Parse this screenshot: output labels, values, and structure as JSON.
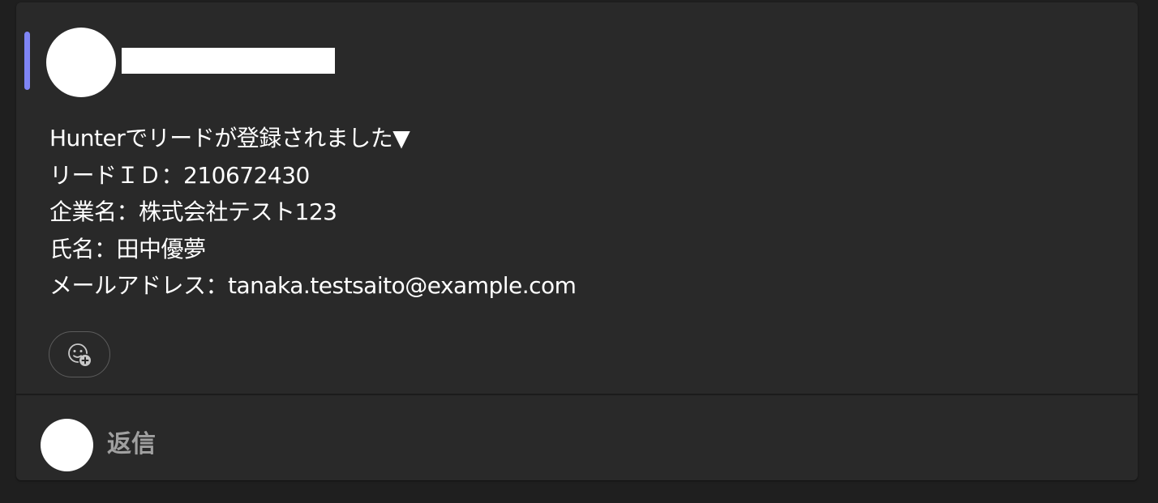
{
  "post": {
    "accent_color": "#7f85f5",
    "sender_name_redacted": true,
    "message_lines": [
      "Hunterでリードが登録されました▼",
      "リードＩＤ：210672430",
      "企業名：株式会社テスト123",
      "氏名：田中優夢",
      "メールアドレス：tanaka.testsaito@example.com"
    ],
    "reaction_icon": "add-reaction-icon"
  },
  "reply": {
    "label": "返信"
  }
}
